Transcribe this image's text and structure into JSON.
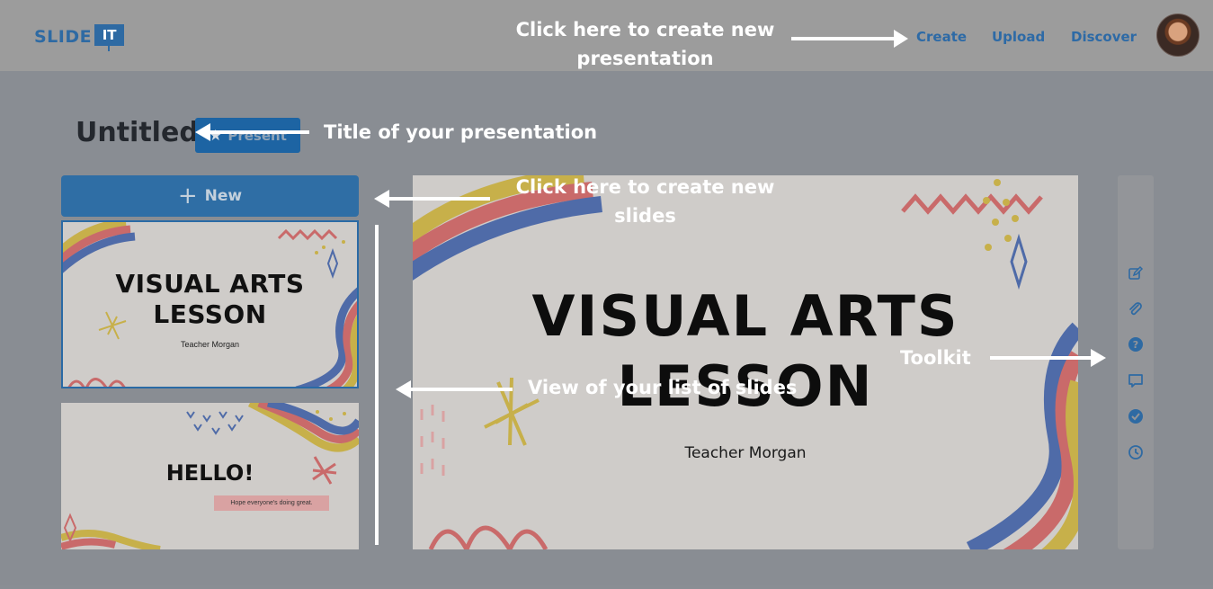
{
  "app": {
    "logo_word": "SLIDE",
    "logo_box": "IT"
  },
  "nav": {
    "create": "Create",
    "upload": "Upload",
    "discover": "Discover"
  },
  "presentation": {
    "title": "Untitled",
    "present_label": "Present"
  },
  "slides_panel": {
    "new_label": "New",
    "slides": [
      {
        "title_line1": "VISUAL ARTS",
        "title_line2": "LESSON",
        "subtitle": "Teacher Morgan"
      },
      {
        "title": "HELLO!",
        "subtitle": "Hope everyone's doing great."
      }
    ]
  },
  "current_slide": {
    "title_line1": "VISUAL ARTS",
    "title_line2": "LESSON",
    "subtitle": "Teacher Morgan"
  },
  "toolkit": {
    "icons": [
      "edit-icon",
      "paperclip-icon",
      "help-icon",
      "comment-icon",
      "check-circle-icon",
      "clock-icon"
    ]
  },
  "annotations": {
    "create_line1": "Click here to create new",
    "create_line2": "presentation",
    "title_note": "Title of your presentation",
    "new_slides_line1": "Click here to create new",
    "new_slides_line2": "slides",
    "list_note": "View of your list of slides",
    "toolkit_note": "Toolkit"
  },
  "colors": {
    "accent": "#2e6aa3",
    "overlay_bg": "#898d93",
    "slide_red": "#c96a6a",
    "slide_blue": "#4f6ba8",
    "slide_yellow": "#c7b04a"
  }
}
